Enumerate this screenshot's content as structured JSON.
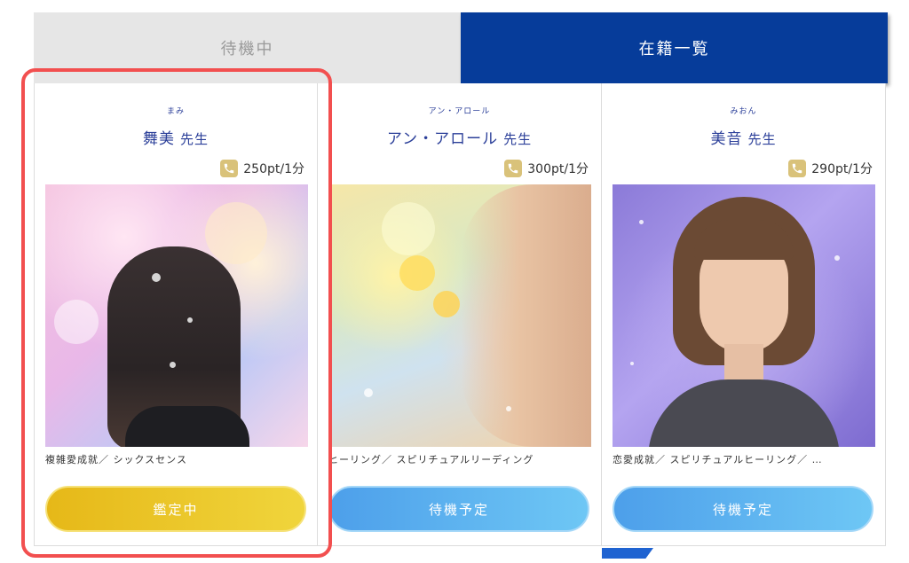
{
  "tabs": {
    "waiting": "待機中",
    "list": "在籍一覧"
  },
  "cards": [
    {
      "kana": "まみ",
      "name": "舞美",
      "sensei": "先生",
      "price": "250pt/1分",
      "tags": "複雑愛成就／ シックスセンス",
      "button": "鑑定中",
      "status": "busy"
    },
    {
      "kana": "アン・アロール",
      "name": "アン・アロール",
      "sensei": "先生",
      "price": "300pt/1分",
      "tags": "ヒーリング／ スピリチュアルリーディング",
      "button": "待機予定",
      "status": "standby"
    },
    {
      "kana": "みおん",
      "name": "美音",
      "sensei": "先生",
      "price": "290pt/1分",
      "tags": "恋愛成就／ スピリチュアルヒーリング／ …",
      "button": "待機予定",
      "status": "standby"
    }
  ],
  "icons": {
    "price": "phone-icon"
  },
  "colors": {
    "accent": "#063c9a",
    "busy": "#e6b818",
    "standby": "#4d9fea",
    "highlight": "#f24f4f"
  }
}
